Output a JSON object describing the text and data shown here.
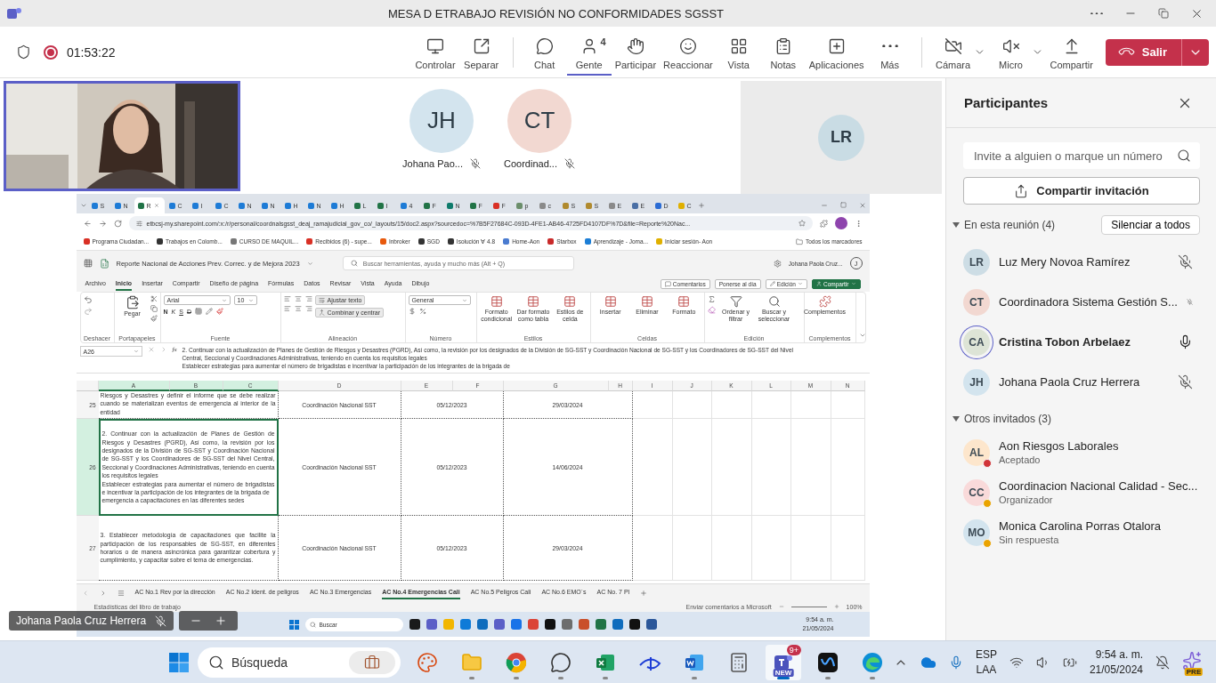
{
  "window": {
    "title": "MESA D ETRABAJO REVISIÓN NO CONFORMIDADES SGSST"
  },
  "call_bar": {
    "timer": "01:53:22",
    "recording": true,
    "share_tools": [
      {
        "kind": "control",
        "label": "Controlar"
      },
      {
        "kind": "popout",
        "label": "Separar"
      }
    ],
    "meeting_tools": [
      {
        "kind": "chat",
        "label": "Chat",
        "selected": false
      },
      {
        "kind": "people",
        "label": "Gente",
        "count": "4",
        "selected": true
      },
      {
        "kind": "raise",
        "label": "Participar",
        "selected": false
      },
      {
        "kind": "react",
        "label": "Reaccionar",
        "selected": false
      },
      {
        "kind": "view",
        "label": "Vista",
        "selected": false
      },
      {
        "kind": "notes",
        "label": "Notas",
        "selected": false
      },
      {
        "kind": "apps",
        "label": "Aplicaciones",
        "selected": false
      },
      {
        "kind": "more",
        "label": "Más",
        "selected": false
      }
    ],
    "device_tools": [
      {
        "kind": "camera",
        "label": "Cámara",
        "off": true,
        "menu": true
      },
      {
        "kind": "mic",
        "label": "Micro",
        "off": true,
        "menu": true
      },
      {
        "kind": "share",
        "label": "Compartir"
      }
    ],
    "leave": {
      "label": "Salir"
    }
  },
  "stage": {
    "tiles": [
      {
        "initials": "JH",
        "name": "Johana Pao...",
        "muted": true,
        "color": "#d3e4ee"
      },
      {
        "initials": "CT",
        "name": "Coordinad...",
        "muted": true,
        "color": "#f2d8d1"
      }
    ],
    "side_tile": {
      "initials": "LR",
      "color": "#c9dce4"
    },
    "name_tag": {
      "name": "Johana Paola Cruz Herrera",
      "muted": true
    }
  },
  "shared_screen": {
    "browser": {
      "tabs": [
        {
          "label": "S",
          "selected": false,
          "color": "#1d7bd6"
        },
        {
          "label": "N",
          "selected": false,
          "color": "#1d7bd6"
        },
        {
          "label": "R",
          "selected": true,
          "color": "#217346"
        },
        {
          "label": "C",
          "selected": false,
          "color": "#1d7bd6"
        },
        {
          "label": "I",
          "selected": false,
          "color": "#1d7bd6"
        },
        {
          "label": "C",
          "selected": false,
          "color": "#1d7bd6"
        },
        {
          "label": "N",
          "selected": false,
          "color": "#1d7bd6"
        },
        {
          "label": "N",
          "selected": false,
          "color": "#1d7bd6"
        },
        {
          "label": "H",
          "selected": false,
          "color": "#1d7bd6"
        },
        {
          "label": "N",
          "selected": false,
          "color": "#1d7bd6"
        },
        {
          "label": "H",
          "selected": false,
          "color": "#1d7bd6"
        },
        {
          "label": "L",
          "selected": false,
          "color": "#217346"
        },
        {
          "label": "I",
          "selected": false,
          "color": "#217346"
        },
        {
          "label": "4",
          "selected": false,
          "color": "#1d7bd6"
        },
        {
          "label": "F",
          "selected": false,
          "color": "#217346"
        },
        {
          "label": "N",
          "selected": false,
          "color": "#0f7b6c"
        },
        {
          "label": "F",
          "selected": false,
          "color": "#217346"
        },
        {
          "label": "F",
          "selected": false,
          "color": "#d93025"
        },
        {
          "label": "p",
          "selected": false,
          "color": "#6b8e6b"
        },
        {
          "label": "c",
          "selected": false,
          "color": "#8a8a8a"
        },
        {
          "label": "S",
          "selected": false,
          "color": "#b08a2e"
        },
        {
          "label": "S",
          "selected": false,
          "color": "#b08a2e"
        },
        {
          "label": "E",
          "selected": false,
          "color": "#8a8a8a"
        },
        {
          "label": "E",
          "selected": false,
          "color": "#4a6fa5"
        },
        {
          "label": "D",
          "selected": false,
          "color": "#2b6cd4"
        },
        {
          "label": "C",
          "selected": false,
          "color": "#e0b000"
        }
      ],
      "url": "etbcsj-my.sharepoint.com/:x:/r/personal/coordnalsgsst_deaj_ramajudicial_gov_co/_layouts/15/doc2.aspx?sourcedoc=%7B5F27684C-093D-4FE1-AB46-4725FD4107DF%7D&file=Reporte%20Nac...",
      "bookmarks": [
        {
          "label": "Programa Ciudadan...",
          "color": "#d93025"
        },
        {
          "label": "Trabajos en Colomb...",
          "color": "#333333"
        },
        {
          "label": "CURSO DE MAQUIL...",
          "color": "#777777"
        },
        {
          "label": "Recibidos (6) - supe...",
          "color": "#d93025"
        },
        {
          "label": "Inbroker",
          "color": "#e8590c"
        },
        {
          "label": "SGD",
          "color": "#333333"
        },
        {
          "label": "Isolución ∀ 4.8",
          "color": "#333333"
        },
        {
          "label": "Home-Aon",
          "color": "#4a7bd0"
        },
        {
          "label": "Starbox",
          "color": "#c92a2a"
        },
        {
          "label": "Aprendizaje - Joma...",
          "color": "#1c7ed6"
        },
        {
          "label": "Iniciar sesión- Aon",
          "color": "#e0b000"
        }
      ],
      "all_bookmarks": "Todos los marcadores"
    },
    "excel": {
      "title": "Reporte Nacional de Acciones Prev. Correc. y de Mejora 2023",
      "search": "Buscar herramientas, ayuda y mucho más (Alt + Q)",
      "user": "Johana Paola Cruz...",
      "user_initial": "J",
      "tabs": [
        {
          "label": "Archivo",
          "selected": false
        },
        {
          "label": "Inicio",
          "selected": true
        },
        {
          "label": "Insertar",
          "selected": false
        },
        {
          "label": "Compartir",
          "selected": false
        },
        {
          "label": "Diseño de página",
          "selected": false
        },
        {
          "label": "Fórmulas",
          "selected": false
        },
        {
          "label": "Datos",
          "selected": false
        },
        {
          "label": "Revisar",
          "selected": false
        },
        {
          "label": "Vista",
          "selected": false
        },
        {
          "label": "Ayuda",
          "selected": false
        },
        {
          "label": "Dibujo",
          "selected": false
        }
      ],
      "comments": "Comentarios",
      "catch_up": "Ponerse al día",
      "mode": "Edición",
      "share": "Compartir",
      "ribbon": [
        {
          "kind": "undo",
          "name": "Deshacer"
        },
        {
          "kind": "clipboard",
          "name": "Portapapeles",
          "paste": "Pegar"
        },
        {
          "kind": "font",
          "name": "Fuente",
          "font": "Arial",
          "size": "10",
          "styles": [
            "N",
            "K",
            "S",
            "D"
          ]
        },
        {
          "kind": "align",
          "name": "Alineación",
          "wrap": "Ajustar texto",
          "merge": "Combinar y centrar"
        },
        {
          "kind": "number",
          "name": "Número",
          "format": "General"
        },
        {
          "kind": "large",
          "name": "Estilos",
          "buttons": [
            "Formato condicional",
            "Dar formato como tabla",
            "Estilos de celda"
          ]
        },
        {
          "kind": "large",
          "name": "Celdas",
          "buttons": [
            "Insertar",
            "Eliminar",
            "Formato"
          ]
        },
        {
          "kind": "edit",
          "name": "Edición",
          "buttons": [
            "Ordenar y filtrar",
            "Buscar y seleccionar"
          ]
        },
        {
          "kind": "large",
          "name": "Complementos",
          "buttons": [
            "Complementos"
          ]
        }
      ],
      "cell_ref": "A26",
      "fx": "fx",
      "formula": [
        "2.  Continuar con la actualización de Planes de Gestión de Riesgos y Desastres (PGRD), Así como, la revisión por los designados de la División de SG-SST y Coordinación Nacional de SG-SST y los Coordinadores de SG-SST del Nivel",
        "Central, Seccional y Coordinaciones Administrativas, teniendo en cuenta los requisitos legales",
        "Establecer estrategias para aumentar el número de brigadistas e incentivar la participación de los integrantes de la brigada de"
      ],
      "columns": [
        "A",
        "B",
        "C",
        "D",
        "E",
        "F",
        "G",
        "H",
        "I",
        "J",
        "K",
        "L",
        "M",
        "N"
      ],
      "rows": [
        {
          "number": "25",
          "selected": false,
          "task": "Riesgos y Desastres y definir el informe que se debe realizar cuando se materializan eventos de emergencia al interior de la entidad",
          "responsible": "Coordinación Nacional SST",
          "start": "05/12/2023",
          "end": "29/03/2024"
        },
        {
          "number": "26",
          "selected": true,
          "task": "2.  Continuar con la actualización de Planes de Gestión de Riesgos y Desastres (PGRD), Así como, la revisión por los designados de la División de SG-SST y Coordinación Nacional de SG-SST y los Coordinadores de SG-SST del Nivel Central, Seccional y Coordinaciones Administrativas, teniendo en cuenta los requisitos legales\nEstablecer estrategias para aumentar el número de brigadistas e incentivar la participación de los integrantes de la brigada de\nemergencia a capacitaciones en las diferentes sedes",
          "responsible": "Coordinación Nacional SST",
          "start": "05/12/2023",
          "end": "14/06/2024"
        },
        {
          "number": "27",
          "selected": false,
          "task": "3.  Establecer metodología de capacitaciones que facilite la participación de los responsables de SG-SST, en diferentes horarios o de manera asincrónica para garantizar cobertura y cumplimiento, y capacitar sobre el tema de emergencias.",
          "responsible": "Coordinación Nacional SST",
          "start": "05/12/2023",
          "end": "29/03/2024"
        }
      ],
      "sheets": [
        {
          "label": "AC No.1 Rev por la dirección",
          "selected": false
        },
        {
          "label": "AC No.2 Ident. de peligros",
          "selected": false
        },
        {
          "label": "AC No.3 Emergencias",
          "selected": false
        },
        {
          "label": "AC No.4 Emergencias Cali",
          "selected": true
        },
        {
          "label": "AC No.5 Peligros Cali",
          "selected": false
        },
        {
          "label": "AC No.6 EMO´s",
          "selected": false
        },
        {
          "label": "AC No. 7 Pl",
          "selected": false
        }
      ],
      "status_left": "Estadísticas del libro de trabajo",
      "feedback": "Enviar comentarios a Microsoft",
      "zoom": "100%"
    },
    "desktop": {
      "search": "Buscar",
      "apps": [
        {
          "color": "#1a1a1a"
        },
        {
          "color": "#5b5fc7"
        },
        {
          "color": "#f2b600"
        },
        {
          "color": "#0f7bd8"
        },
        {
          "color": "#0f6cbd"
        },
        {
          "color": "#5b5fc7"
        },
        {
          "color": "#1a73e8"
        },
        {
          "color": "#db4437"
        },
        {
          "color": "#111111"
        },
        {
          "color": "#6d6d6d"
        },
        {
          "color": "#c94f2a"
        },
        {
          "color": "#217346"
        },
        {
          "color": "#0f6cbd"
        },
        {
          "color": "#111111"
        },
        {
          "color": "#2b579a"
        }
      ],
      "time": "9:54 a. m.",
      "date": "21/05/2024"
    }
  },
  "panel": {
    "title": "Participantes",
    "search_placeholder": "Invite a alguien o marque un número",
    "invite": "Compartir invitación",
    "sections": [
      {
        "title": "En esta reunión (4)",
        "expanded": true,
        "action": "Silenciar a todos",
        "people": [
          {
            "initials": "LR",
            "name": "Luz Mery Novoa Ramírez",
            "color": "#cddde5",
            "muted": true,
            "speaking": false
          },
          {
            "initials": "CT",
            "name": "Coordinadora Sistema Gestión S...",
            "color": "#f2d8d1",
            "muted": true,
            "speaking": false
          },
          {
            "initials": "CA",
            "name": "Cristina Tobon Arbelaez",
            "color": "#dde4d6",
            "muted": false,
            "speaking": true
          },
          {
            "initials": "JH",
            "name": "Johana Paola Cruz Herrera",
            "color": "#d3e4ee",
            "muted": true,
            "speaking": false
          }
        ]
      },
      {
        "title": "Otros invitados (3)",
        "expanded": true,
        "people": [
          {
            "initials": "AL",
            "name": "Aon Riesgos Laborales",
            "status": "Aceptado",
            "color": "#fde6cc",
            "presence": {
              "color": "#d13438"
            }
          },
          {
            "initials": "CC",
            "name": "Coordinacion Nacional Calidad - Sec...",
            "status": "Organizador",
            "color": "#f9dada",
            "presence": {
              "color": "#eaa300"
            }
          },
          {
            "initials": "MO",
            "name": "Monica Carolina Porras Otalora",
            "status": "Sin respuesta",
            "color": "#d3e4ee",
            "presence": {
              "color": "#eaa300"
            }
          }
        ]
      }
    ]
  },
  "taskbar": {
    "search": "Búsqueda",
    "apps": [
      {
        "kind": "palette",
        "running": false,
        "selected": false
      },
      {
        "kind": "folder",
        "running": true,
        "selected": false
      },
      {
        "kind": "chrome",
        "running": true,
        "selected": false
      },
      {
        "kind": "whatsapp",
        "running": true,
        "selected": false
      },
      {
        "kind": "excel",
        "running": true,
        "selected": false
      },
      {
        "kind": "disney",
        "running": false,
        "selected": false
      },
      {
        "kind": "word",
        "running": true,
        "selected": false
      },
      {
        "kind": "calculator",
        "running": false,
        "selected": false
      },
      {
        "kind": "teams",
        "running": true,
        "selected": true,
        "badge": "9+",
        "tag": "NEW"
      },
      {
        "kind": "wave",
        "running": true,
        "selected": false
      },
      {
        "kind": "edge",
        "running": true,
        "selected": false
      }
    ],
    "lang": "ESP",
    "layout": "LAA",
    "time": "9:54 a. m.",
    "date": "21/05/2024",
    "copilot_tag": "PRE"
  }
}
